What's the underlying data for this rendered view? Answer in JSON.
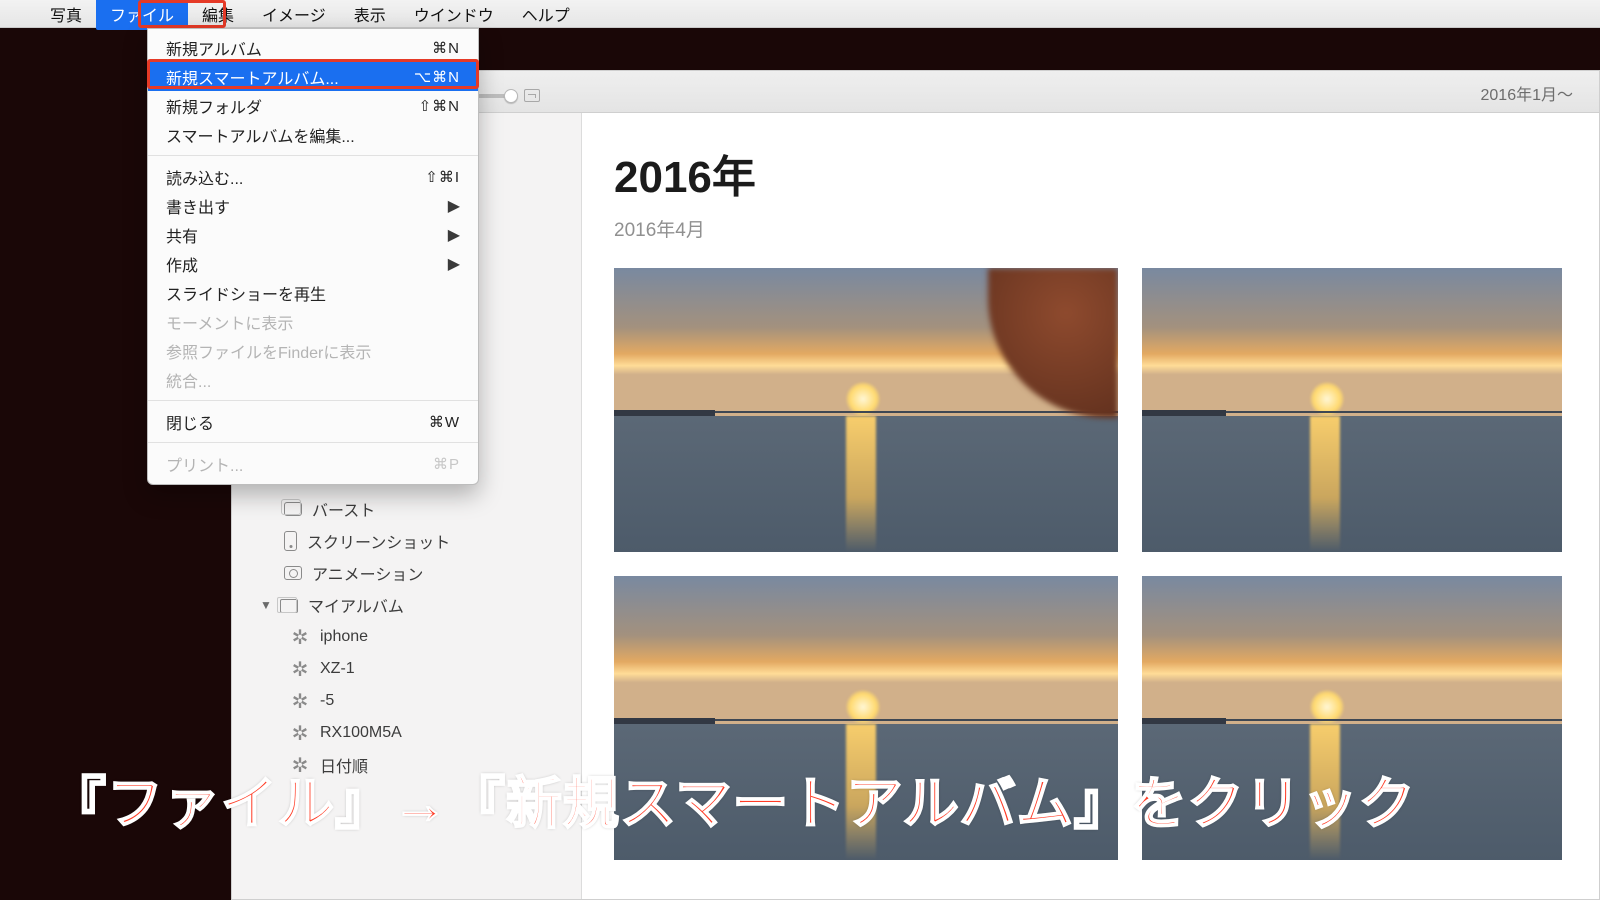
{
  "menubar": {
    "app": "写真",
    "items": [
      "ファイル",
      "編集",
      "イメージ",
      "表示",
      "ウインドウ",
      "ヘルプ"
    ],
    "selected_index": 0
  },
  "dropdown": {
    "items": [
      {
        "label": "新規アルバム",
        "shortcut": "⌘N"
      },
      {
        "label": "新規スマートアルバム...",
        "shortcut": "⌥⌘N",
        "selected": true
      },
      {
        "label": "新規フォルダ",
        "shortcut": "⇧⌘N"
      },
      {
        "label": "スマートアルバムを編集..."
      },
      {
        "sep": true
      },
      {
        "label": "読み込む...",
        "shortcut": "⇧⌘I"
      },
      {
        "label": "書き出す",
        "submenu": true
      },
      {
        "label": "共有",
        "submenu": true
      },
      {
        "label": "作成",
        "submenu": true
      },
      {
        "label": "スライドショーを再生"
      },
      {
        "label": "モーメントに表示",
        "disabled": true
      },
      {
        "label": "参照ファイルをFinderに表示",
        "disabled": true
      },
      {
        "label": "統合...",
        "disabled": true
      },
      {
        "sep": true
      },
      {
        "label": "閉じる",
        "shortcut": "⌘W"
      },
      {
        "sep": true
      },
      {
        "label": "プリント...",
        "shortcut": "⌘P",
        "disabled": true
      }
    ]
  },
  "toolbar": {
    "date_range": "2016年1月～"
  },
  "content": {
    "year_heading": "2016年",
    "month_heading": "2016年4月"
  },
  "sidebar": {
    "items": [
      {
        "label": "バースト",
        "icon": "burst"
      },
      {
        "label": "スクリーンショット",
        "icon": "phone"
      },
      {
        "label": "アニメーション",
        "icon": "anim"
      }
    ],
    "group": {
      "label": "マイアルバム",
      "icon": "folder"
    },
    "smart": [
      {
        "label": "iphone"
      },
      {
        "label": "XZ-1"
      },
      {
        "label": "-5"
      },
      {
        "label": "RX100M5A"
      },
      {
        "label": "日付順"
      }
    ]
  },
  "caption": "『ファイル』→『新規スマートアルバム』をクリック"
}
